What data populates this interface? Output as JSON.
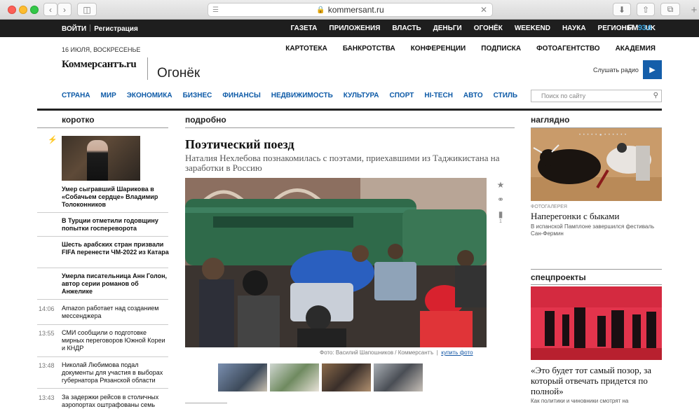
{
  "browser": {
    "url": "kommersant.ru"
  },
  "topbar": {
    "login": "ВОЙТИ",
    "register": "Регистрация",
    "nav": [
      "ГАЗЕТА",
      "ПРИЛОЖЕНИЯ",
      "ВЛАСТЬ",
      "ДЕНЬГИ",
      "ОГОНЁК",
      "WEEKEND",
      "НАУКА",
      "РЕГИОНЫ",
      "UK"
    ],
    "fm_prefix": "FM",
    "fm_freq": "93.6"
  },
  "header": {
    "date": "16 ИЮЛЯ, ВОСКРЕСЕНЬЕ",
    "secnav": [
      "КАРТОТЕКА",
      "БАНКРОТСТВА",
      "КОНФЕРЕНЦИИ",
      "ПОДПИСКА",
      "ФОТОАГЕНТСТВО",
      "АКАДЕМИЯ"
    ],
    "logo": "Коммерсантъ.ru",
    "section": "Огонёк",
    "radio_label": "Слушать радио",
    "mainnav": [
      "СТРАНА",
      "МИР",
      "ЭКОНОМИКА",
      "БИЗНЕС",
      "ФИНАНСЫ",
      "НЕДВИЖИМОСТЬ",
      "КУЛЬТУРА",
      "СПОРТ",
      "HI-TECH",
      "АВТО",
      "СТИЛЬ"
    ],
    "search_placeholder": "Поиск по сайту"
  },
  "left": {
    "heading": "коротко",
    "items": [
      "Умер сыгравший Шарикова в «Собачьем сердце» Владимир Толоконников",
      "В Турции отметили годовщину попытки госпереворота",
      "Шесть арабских стран призвали FIFA перенести ЧМ-2022 из Катара",
      "Умерла писательница Анн Голон, автор серии романов об Анжелике"
    ],
    "timed": [
      {
        "time": "14:06",
        "text": "Amazon работает над созданием мессенджера"
      },
      {
        "time": "13:55",
        "text": "СМИ сообщили о подготовке мирных переговоров Южной Кореи и КНДР"
      },
      {
        "time": "13:48",
        "text": "Николай Любимова подал документы для участия в выборах губернатора Рязанской области"
      },
      {
        "time": "13:43",
        "text": "За задержки рейсов в столичных аэропортах оштрафованы семь"
      }
    ]
  },
  "center": {
    "heading": "подробно",
    "title": "Поэтический поезд",
    "subtitle": "Наталия Нехлебова познакомилась с поэтами, приехавшими из Таджикистана на заработки в Россию",
    "credit": "Фото: Василий Шапошников / Коммерсантъ",
    "buy": "купить фото",
    "comments": "1"
  },
  "right": {
    "heading1": "наглядно",
    "gallery_label": "ФОТОГАЛЕРЕЯ",
    "gallery_title": "Наперегонки с быками",
    "gallery_desc": "В испанской Памплоне завершился фестиваль Сан-Фермин",
    "heading2": "спецпроекты",
    "spec_title": "«Это будет тот самый позор, за который отвечать придется по полной»",
    "spec_desc": "Как политики и чиновники смотрят на"
  },
  "colors": {
    "accent": "#0d5aa7",
    "radio": "#145eaa",
    "topbar": "#1e1e1e",
    "spec": "#e4324a"
  }
}
